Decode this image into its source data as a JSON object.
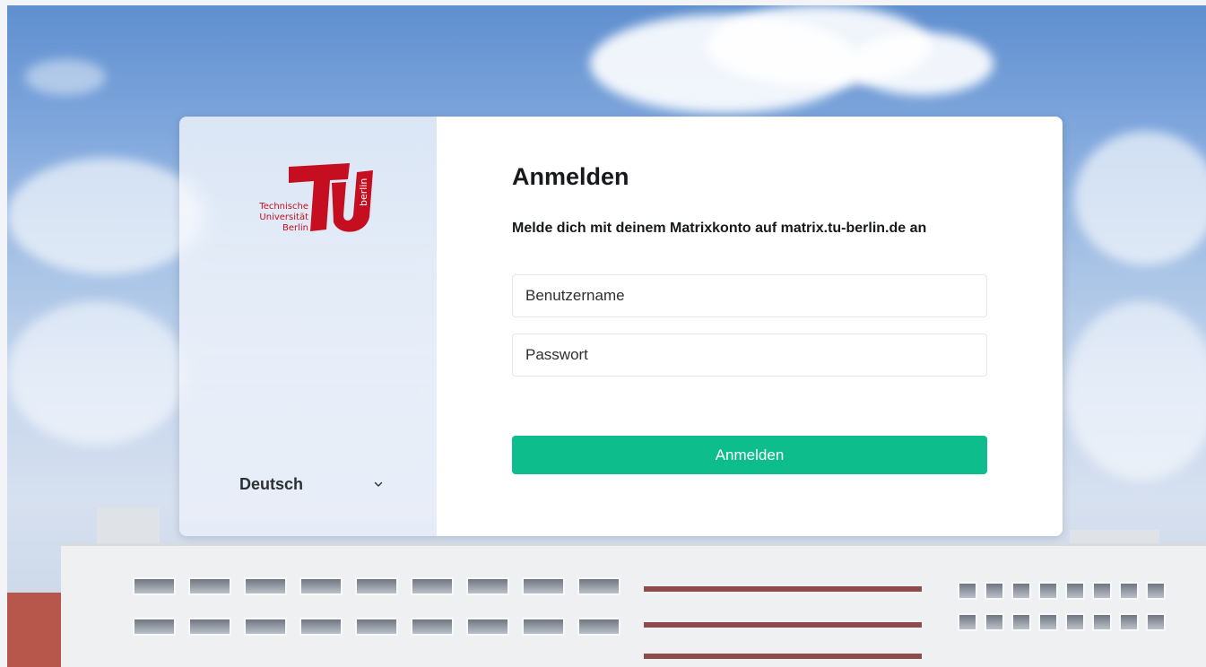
{
  "brand": {
    "logo_lines": [
      "Technische",
      "Universität",
      "Berlin"
    ],
    "logo_vertical": "berlin",
    "color": "#c50e1f"
  },
  "language": {
    "selected": "Deutsch",
    "icon": "chevron-down-icon"
  },
  "login": {
    "title": "Anmelden",
    "subtitle": "Melde dich mit deinem Matrixkonto auf matrix.tu-berlin.de an",
    "username_placeholder": "Benutzername",
    "password_placeholder": "Passwort",
    "submit_label": "Anmelden",
    "accent": "#0dbd8b"
  }
}
